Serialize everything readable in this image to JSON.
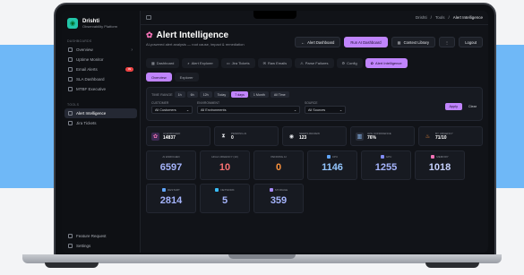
{
  "colors": {
    "band": "#1a8ef5",
    "accent": "#c084fc",
    "total": "#a5b4fc",
    "high": "#f87171",
    "pending": "#fb923c",
    "cpu": "#93c5fd",
    "gpu": "#a5b4fc",
    "memory": "#c7d2fe"
  },
  "sidebar": {
    "brand_name": "Drishti",
    "brand_sub": "Observability Platform",
    "dashboards_label": "DASHBOARDS",
    "tools_label": "TOOLS",
    "items": [
      {
        "label": "Overview",
        "icon": "grid-icon"
      },
      {
        "label": "Uptime Monitor",
        "icon": "pulse-icon"
      },
      {
        "label": "Email Alerts",
        "icon": "mail-icon",
        "badge": "99"
      },
      {
        "label": "SLA Dashboard",
        "icon": "chart-icon"
      },
      {
        "label": "MTBF Executive",
        "icon": "clock-icon"
      }
    ],
    "tools": [
      {
        "label": "Alert Intelligence",
        "icon": "brain-icon"
      },
      {
        "label": "Jira Tickets",
        "icon": "ticket-icon"
      }
    ],
    "footer": [
      {
        "label": "Feature Request",
        "icon": "bulb-icon"
      },
      {
        "label": "Settings",
        "icon": "gear-icon"
      }
    ]
  },
  "topbar": {
    "crumb_root": "Drishti",
    "crumb_tools": "Tools",
    "crumb_current": "Alert Intelligence"
  },
  "header": {
    "title": "Alert Intelligence",
    "subtitle": "AI-powered alert analysis — root cause, impact & remediation",
    "buttons": {
      "alert_dashboard": "Alert Dashboard",
      "run_ai": "Run AI Dashboard",
      "context_library": "Context Library",
      "logout": "Logout"
    }
  },
  "tabs": [
    "Dashboard",
    "Alert Explorer",
    "Jira Tickets",
    "Raw Emails",
    "Parse Failures",
    "Config",
    "Alert Intelligence"
  ],
  "subtabs": [
    "Overview",
    "Explorer"
  ],
  "filters": {
    "time_range_label": "TIME RANGE",
    "ranges": [
      "1h",
      "6h",
      "12h",
      "Today",
      "7 days",
      "1 Month",
      "All Time"
    ],
    "customer_label": "CUSTOMER",
    "customer_value": "All Customers",
    "environment_label": "ENVIRONMENT",
    "environment_value": "All Environments",
    "source_label": "SOURCE",
    "source_value": "All Sources",
    "apply": "Apply",
    "clear": "Clear"
  },
  "stats": [
    {
      "label": "AI ENRICHED",
      "value": "14837",
      "icon": "brain-icon"
    },
    {
      "label": "PENDING AI",
      "value": "0",
      "icon": "hourglass-icon"
    },
    {
      "label": "NEEDS REVIEW",
      "value": "123",
      "icon": "eye-icon"
    },
    {
      "label": "AVG CONFIDENCE",
      "value": "76%",
      "icon": "chart-icon"
    },
    {
      "label": "BY URGENCY",
      "value": "71/10",
      "icon": "fire-icon"
    }
  ],
  "cards": [
    {
      "label": "AI ENRICHED",
      "value": "6597",
      "color": "#a5b4fc"
    },
    {
      "label": "HIGH URGENCY (10)",
      "value": "10",
      "color": "#f87171"
    },
    {
      "label": "PENDING AI",
      "value": "0",
      "color": "#fb923c"
    },
    {
      "label": "CPU",
      "value": "1146",
      "color": "#93c5fd"
    },
    {
      "label": "GPU",
      "value": "1255",
      "color": "#a5b4fc"
    },
    {
      "label": "MEMORY",
      "value": "1018",
      "color": "#c7d2fe"
    },
    {
      "label": "RESTART",
      "value": "2814",
      "color": "#a5b4fc"
    },
    {
      "label": "NETWORK",
      "value": "5",
      "color": "#a5b4fc"
    },
    {
      "label": "STORAGE",
      "value": "359",
      "color": "#a5b4fc"
    }
  ]
}
